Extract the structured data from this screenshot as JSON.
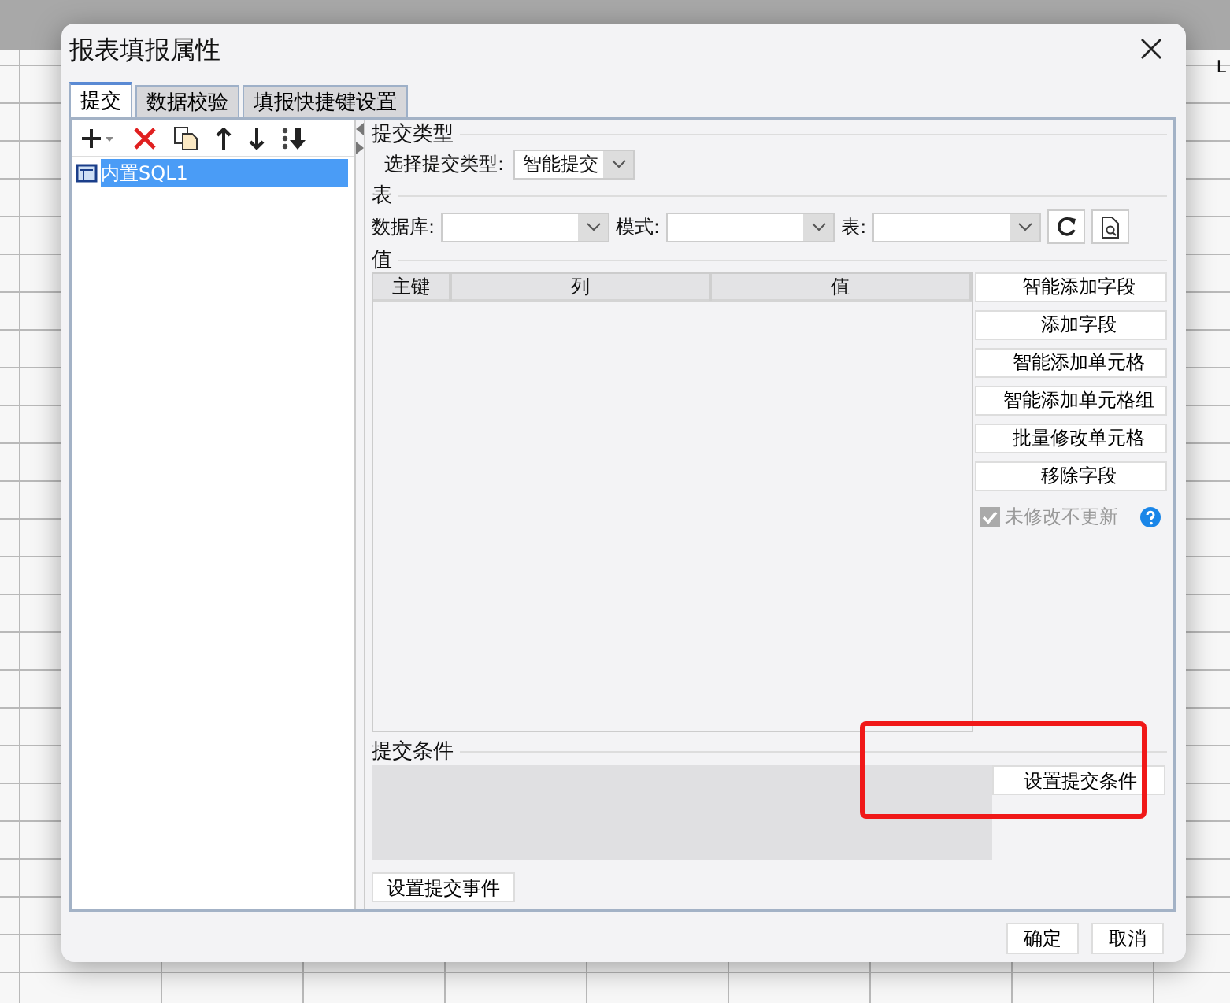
{
  "background": {
    "cell_text": "L"
  },
  "dialog": {
    "title": "报表填报属性",
    "tabs": [
      {
        "label": "提交",
        "selected": true
      },
      {
        "label": "数据校验",
        "selected": false
      },
      {
        "label": "填报快捷键设置",
        "selected": false
      }
    ],
    "tree": [
      {
        "label": "内置SQL1",
        "selected": true
      }
    ],
    "submit_type": {
      "heading": "提交类型",
      "label": "选择提交类型:",
      "value": "智能提交"
    },
    "table_section": {
      "heading": "表",
      "fields": [
        {
          "label": "数据库:"
        },
        {
          "label": "模式:"
        },
        {
          "label": "表:"
        }
      ]
    },
    "value_section": {
      "heading": "值",
      "columns": [
        "主键",
        "列",
        "值"
      ],
      "buttons": [
        "智能添加字段",
        "添加字段",
        "智能添加单元格",
        "智能添加单元格组",
        "批量修改单元格",
        "移除字段"
      ],
      "checkbox": {
        "label": "未修改不更新",
        "checked": true,
        "disabled": true
      }
    },
    "condition_section": {
      "heading": "提交条件",
      "button": "设置提交条件"
    },
    "event_button": "设置提交事件",
    "footer_buttons": [
      "确定",
      "取消"
    ]
  }
}
